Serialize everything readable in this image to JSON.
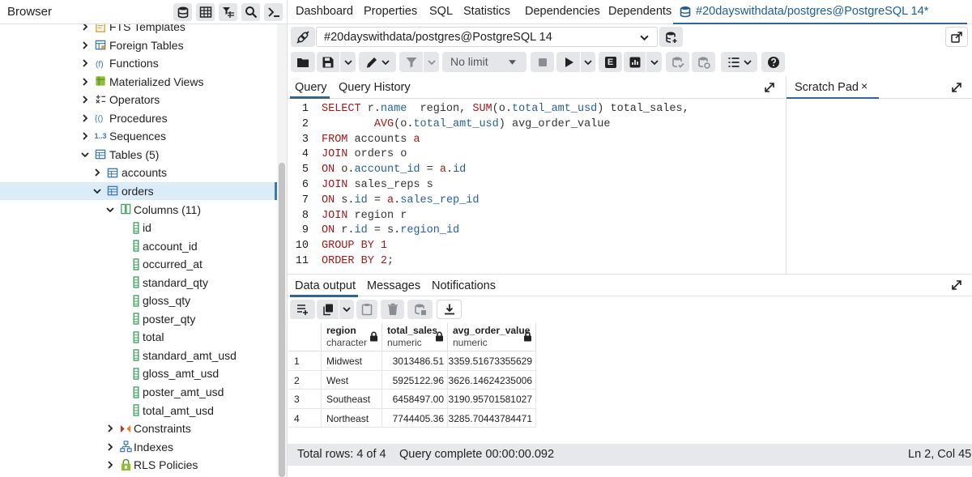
{
  "browser": {
    "title": "Browser",
    "tree": [
      {
        "label": "FTS Templates",
        "icon": "fts-templates-icon",
        "expanded": false
      },
      {
        "label": "Foreign Tables",
        "icon": "foreign-table-icon",
        "expanded": false
      },
      {
        "label": "Functions",
        "icon": "function-icon",
        "expanded": false
      },
      {
        "label": "Materialized Views",
        "icon": "materialized-view-icon",
        "expanded": false
      },
      {
        "label": "Operators",
        "icon": "operator-icon",
        "expanded": false
      },
      {
        "label": "Procedures",
        "icon": "procedure-icon",
        "expanded": false
      },
      {
        "label": "Sequences",
        "icon": "sequence-icon",
        "icon_text": "1..3",
        "expanded": false
      },
      {
        "label": "Tables (5)",
        "icon": "table-icon",
        "expanded": true
      },
      {
        "label": "accounts",
        "icon": "table-icon",
        "expanded": false
      },
      {
        "label": "orders",
        "icon": "table-icon",
        "expanded": true,
        "selected": true
      },
      {
        "label": "Columns (11)",
        "icon": "columns-icon",
        "expanded": true
      },
      {
        "label": "id",
        "icon": "column-icon"
      },
      {
        "label": "account_id",
        "icon": "column-icon"
      },
      {
        "label": "occurred_at",
        "icon": "column-icon"
      },
      {
        "label": "standard_qty",
        "icon": "column-icon"
      },
      {
        "label": "gloss_qty",
        "icon": "column-icon"
      },
      {
        "label": "poster_qty",
        "icon": "column-icon"
      },
      {
        "label": "total",
        "icon": "column-icon"
      },
      {
        "label": "standard_amt_usd",
        "icon": "column-icon"
      },
      {
        "label": "gloss_amt_usd",
        "icon": "column-icon"
      },
      {
        "label": "poster_amt_usd",
        "icon": "column-icon"
      },
      {
        "label": "total_amt_usd",
        "icon": "column-icon"
      },
      {
        "label": "Constraints",
        "icon": "constraint-icon",
        "expanded": false
      },
      {
        "label": "Indexes",
        "icon": "index-icon",
        "expanded": false
      },
      {
        "label": "RLS Policies",
        "icon": "rls-policy-icon",
        "expanded": false
      }
    ]
  },
  "tabs": {
    "dashboard": "Dashboard",
    "properties": "Properties",
    "sql": "SQL",
    "statistics": "Statistics",
    "dependencies": "Dependencies",
    "dependents": "Dependents",
    "query_tool": "#20dayswithdata/postgres@PostgreSQL 14*"
  },
  "connection": {
    "selected": "#20dayswithdata/postgres@PostgreSQL 14"
  },
  "toolbar": {
    "limit": "No limit",
    "execute_explain_label": "E"
  },
  "query_panel": {
    "tab_query": "Query",
    "tab_history": "Query History",
    "line_numbers": [
      "1",
      "2",
      "3",
      "4",
      "5",
      "6",
      "7",
      "8",
      "9",
      "10",
      "11"
    ]
  },
  "scratch_pad": {
    "label": "Scratch Pad",
    "close": "×"
  },
  "results": {
    "tab_data": "Data output",
    "tab_messages": "Messages",
    "tab_notifications": "Notifications",
    "columns": [
      {
        "name": "region",
        "type": "character"
      },
      {
        "name": "total_sales",
        "type": "numeric"
      },
      {
        "name": "avg_order_value",
        "type": "numeric"
      }
    ],
    "rows": [
      {
        "n": "1",
        "region": "Midwest",
        "total_sales": "3013486.51",
        "avg_order_value": "3359.51673355629"
      },
      {
        "n": "2",
        "region": "West",
        "total_sales": "5925122.96",
        "avg_order_value": "3626.14624235006"
      },
      {
        "n": "3",
        "region": "Southeast",
        "total_sales": "6458497.00",
        "avg_order_value": "3190.95701581027"
      },
      {
        "n": "4",
        "region": "Northeast",
        "total_sales": "7744405.36",
        "avg_order_value": "3285.70443784471"
      }
    ]
  },
  "status": {
    "total_rows": "Total rows: 4 of 4",
    "query_complete": "Query complete 00:00:00.092",
    "cursor": "Ln 2, Col 45"
  },
  "colors": {
    "accent": "#326690",
    "selected_row": "#dbebf8",
    "keyword": "#9c1a1a",
    "column_ref": "#2a6099",
    "button_bg": "#e4e6ea"
  }
}
